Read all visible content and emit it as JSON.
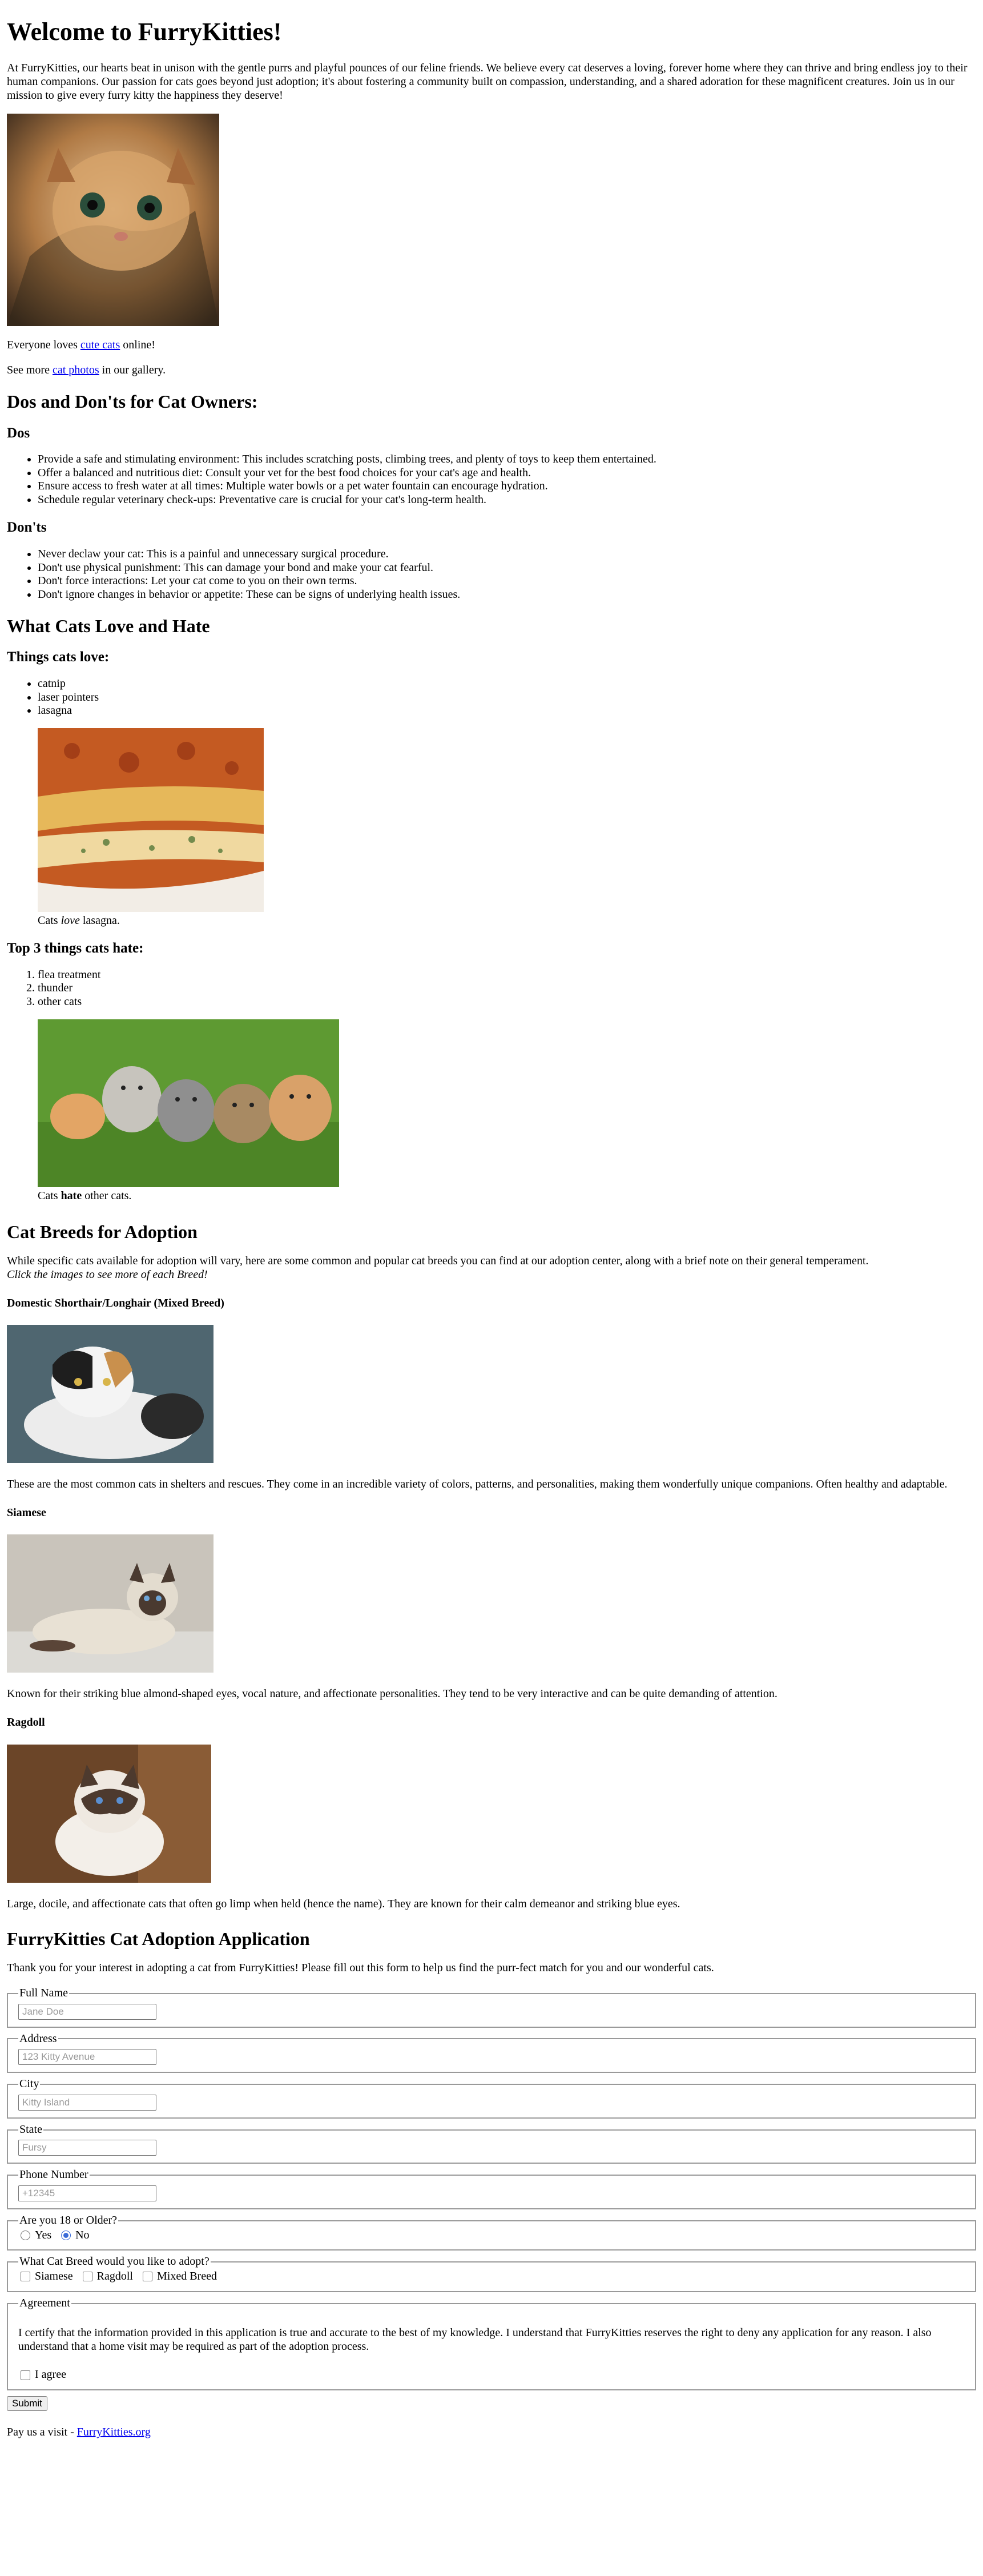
{
  "header": {
    "title": "Welcome to FurryKitties!",
    "intro": "At FurryKitties, our hearts beat in unison with the gentle purrs and playful pounces of our feline friends. We believe every cat deserves a loving, forever home where they can thrive and bring endless joy to their human companions. Our passion for cats goes beyond just adoption; it's about fostering a community built on compassion, understanding, and a shared adoration for these magnificent creatures. Join us in our mission to give every furry kitty the happiness they deserve!"
  },
  "lines": {
    "everyone_prefix": "Everyone loves ",
    "everyone_link": "cute cats",
    "everyone_suffix": " online!",
    "seemore_prefix": "See more ",
    "seemore_link": "cat photos",
    "seemore_suffix": " in our gallery."
  },
  "dosdonts": {
    "heading": "Dos and Don'ts for Cat Owners:",
    "dos_heading": "Dos",
    "dos": [
      "Provide a safe and stimulating environment: This includes scratching posts, climbing trees, and plenty of toys to keep them entertained.",
      "Offer a balanced and nutritious diet: Consult your vet for the best food choices for your cat's age and health.",
      "Ensure access to fresh water at all times: Multiple water bowls or a pet water fountain can encourage hydration.",
      "Schedule regular veterinary check-ups: Preventative care is crucial for your cat's long-term health."
    ],
    "donts_heading": "Don'ts",
    "donts": [
      "Never declaw your cat: This is a painful and unnecessary surgical procedure.",
      "Don't use physical punishment: This can damage your bond and make your cat fearful.",
      "Don't force interactions: Let your cat come to you on their own terms.",
      "Don't ignore changes in behavior or appetite: These can be signs of underlying health issues."
    ]
  },
  "lovehate": {
    "heading": "What Cats Love and Hate",
    "love_heading": "Things cats love:",
    "love": [
      "catnip",
      "laser pointers",
      "lasagna"
    ],
    "love_caption_prefix": "Cats ",
    "love_caption_em": "love",
    "love_caption_suffix": " lasagna.",
    "hate_heading": "Top 3 things cats hate:",
    "hate": [
      "flea treatment",
      "thunder",
      "other cats"
    ],
    "hate_caption_prefix": "Cats ",
    "hate_caption_strong": "hate",
    "hate_caption_suffix": " other cats."
  },
  "breeds": {
    "heading": "Cat Breeds for Adoption",
    "intro": "While specific cats available for adoption will vary, here are some common and popular cat breeds you can find at our adoption center, along with a brief note on their general temperament.",
    "intro_em": "Click the images to see more of each Breed!",
    "items": [
      {
        "name": "Domestic Shorthair/Longhair (Mixed Breed)",
        "desc": "These are the most common cats in shelters and rescues. They come in an incredible variety of colors, patterns, and personalities, making them wonderfully unique companions. Often healthy and adaptable."
      },
      {
        "name": "Siamese",
        "desc": "Known for their striking blue almond-shaped eyes, vocal nature, and affectionate personalities. They tend to be very interactive and can be quite demanding of attention."
      },
      {
        "name": "Ragdoll",
        "desc": "Large, docile, and affectionate cats that often go limp when held (hence the name). They are known for their calm demeanor and striking blue eyes."
      }
    ]
  },
  "form": {
    "heading": "FurryKitties Cat Adoption Application",
    "intro": "Thank you for your interest in adopting a cat from FurryKitties! Please fill out this form to help us find the purr-fect match for you and our wonderful cats.",
    "fields": [
      {
        "legend": "Full Name",
        "placeholder": "Jane Doe"
      },
      {
        "legend": "Address",
        "placeholder": "123 Kitty Avenue"
      },
      {
        "legend": "City",
        "placeholder": "Kitty Island"
      },
      {
        "legend": "State",
        "placeholder": "Fursy"
      },
      {
        "legend": "Phone Number",
        "placeholder": "+12345"
      }
    ],
    "age_legend": "Are you 18 or Older?",
    "age_yes": "Yes",
    "age_no": "No",
    "age_selected": "No",
    "breed_legend": "What Cat Breed would you like to adopt?",
    "breed_options": [
      "Siamese",
      "Ragdoll",
      "Mixed Breed"
    ],
    "agreement_legend": "Agreement",
    "agreement_text": "I certify that the information provided in this application is true and accurate to the best of my knowledge. I understand that FurryKitties reserves the right to deny any application for any reason. I also understand that a home visit may be required as part of the adoption process.",
    "agree_label": "I agree",
    "submit_label": "Submit"
  },
  "footer": {
    "prefix": "Pay us a visit - ",
    "link": "FurryKitties.org"
  },
  "colors": {
    "link": "#0000ee",
    "radio_checked": "#3a6bd8",
    "fieldset_border": "#9a9a9a"
  }
}
